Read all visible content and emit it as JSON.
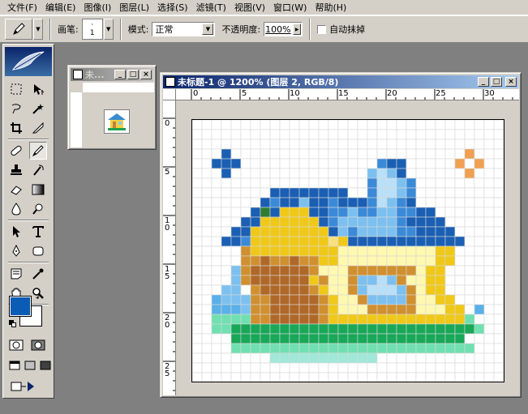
{
  "menu": [
    {
      "label": "文件(F)",
      "id": "file"
    },
    {
      "label": "编辑(E)",
      "id": "edit"
    },
    {
      "label": "图像(I)",
      "id": "image"
    },
    {
      "label": "图层(L)",
      "id": "layer"
    },
    {
      "label": "选择(S)",
      "id": "select"
    },
    {
      "label": "滤镜(T)",
      "id": "filter"
    },
    {
      "label": "视图(V)",
      "id": "view"
    },
    {
      "label": "窗口(W)",
      "id": "window"
    },
    {
      "label": "帮助(H)",
      "id": "help"
    }
  ],
  "options": {
    "brush_label": "画笔:",
    "brush_size": "1",
    "mode_label": "模式:",
    "mode_value": "正常",
    "opacity_label": "不透明度:",
    "opacity_value": "100%",
    "auto_erase_label": "自动抹掉",
    "auto_erase_checked": false
  },
  "navigator": {
    "title": "未..."
  },
  "document": {
    "title": "未标题-1 @ 1200% (图层 2, RGB/8)",
    "ruler_h": [
      "0",
      "5",
      "10",
      "15",
      "20",
      "25",
      "30"
    ],
    "ruler_v": [
      "0",
      "5",
      "1 0",
      "1 5",
      "2 0",
      "2 5"
    ]
  },
  "colors": {
    "foreground": "#0a5cb4",
    "background": "#ffffff",
    "grid": "#d8d8d8"
  },
  "icons": {
    "pencil": "pencil-icon",
    "marquee": "marquee-icon",
    "move": "move-icon"
  }
}
